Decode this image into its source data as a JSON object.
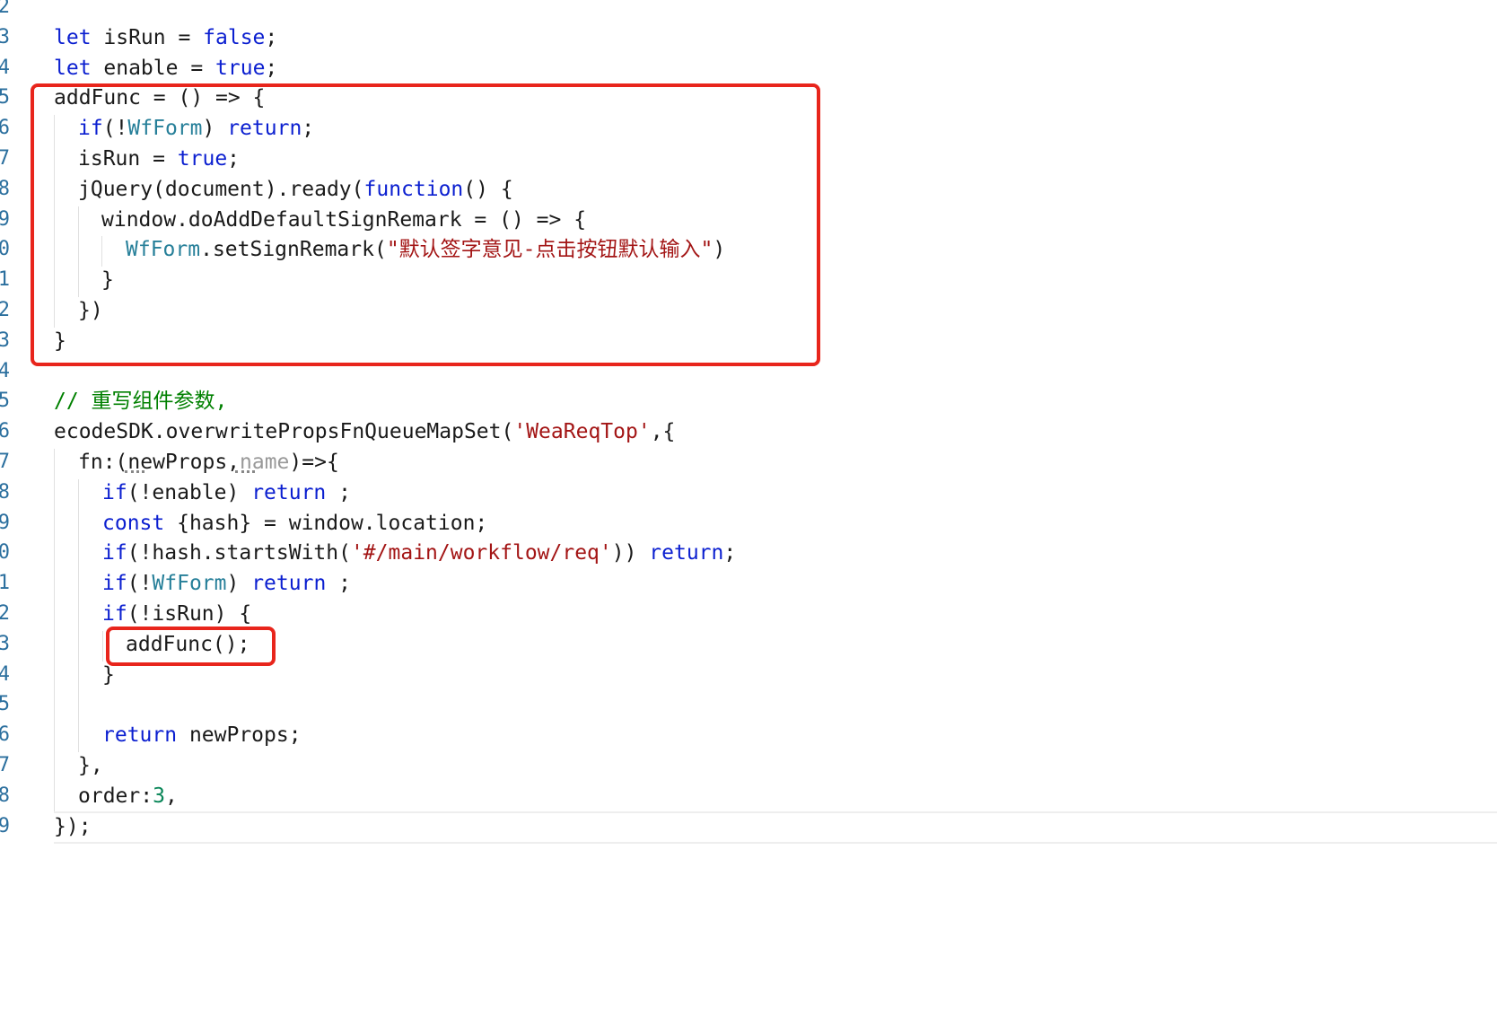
{
  "gutter": {
    "line_numbers": [
      "2",
      "3",
      "4",
      "5",
      "6",
      "7",
      "8",
      "9",
      "0",
      "1",
      "2",
      "3",
      "4",
      "5",
      "6",
      "7",
      "8",
      "9",
      "0",
      "1",
      "2",
      "3",
      "4",
      "5",
      "6",
      "7",
      "8",
      "9"
    ]
  },
  "code": {
    "lines": [
      [],
      [
        {
          "t": "let",
          "c": "kw"
        },
        {
          "t": " isRun = "
        },
        {
          "t": "false",
          "c": "kw"
        },
        {
          "t": ";"
        }
      ],
      [
        {
          "t": "let",
          "c": "kw"
        },
        {
          "t": " enable = "
        },
        {
          "t": "true",
          "c": "kw"
        },
        {
          "t": ";"
        }
      ],
      [
        {
          "t": "addFunc = () => {"
        }
      ],
      [
        {
          "t": "if",
          "c": "kw"
        },
        {
          "t": "(!"
        },
        {
          "t": "WfForm",
          "c": "ty"
        },
        {
          "t": ") "
        },
        {
          "t": "return",
          "c": "kw"
        },
        {
          "t": ";"
        }
      ],
      [
        {
          "t": "isRun = "
        },
        {
          "t": "true",
          "c": "kw"
        },
        {
          "t": ";"
        }
      ],
      [
        {
          "t": "jQuery(document).ready("
        },
        {
          "t": "function",
          "c": "kw"
        },
        {
          "t": "() {"
        }
      ],
      [
        {
          "t": "window.doAddDefaultSignRemark = () => {"
        }
      ],
      [
        {
          "t": "WfForm",
          "c": "ty"
        },
        {
          "t": ".setSignRemark("
        },
        {
          "t": "\"默认签字意见-点击按钮默认输入\"",
          "c": "str"
        },
        {
          "t": ")"
        }
      ],
      [
        {
          "t": "}"
        }
      ],
      [
        {
          "t": "})"
        }
      ],
      [
        {
          "t": "}"
        }
      ],
      [],
      [
        {
          "t": "// 重写组件参数,",
          "c": "cm"
        }
      ],
      [
        {
          "t": "ecodeSDK.overwritePropsFnQueueMapSet("
        },
        {
          "t": "'WeaReqTop'",
          "c": "str"
        },
        {
          "t": ",{"
        }
      ],
      [
        {
          "t": "fn:(newProps,"
        },
        {
          "t": "name",
          "c": "pm"
        },
        {
          "t": ")=>{"
        }
      ],
      [
        {
          "t": "if",
          "c": "kw"
        },
        {
          "t": "(!enable) "
        },
        {
          "t": "return",
          "c": "kw"
        },
        {
          "t": " ;"
        }
      ],
      [
        {
          "t": "const",
          "c": "kw"
        },
        {
          "t": " {hash} = window.location;"
        }
      ],
      [
        {
          "t": "if",
          "c": "kw"
        },
        {
          "t": "(!hash.startsWith("
        },
        {
          "t": "'#/main/workflow/req'",
          "c": "str"
        },
        {
          "t": ")) "
        },
        {
          "t": "return",
          "c": "kw"
        },
        {
          "t": ";"
        }
      ],
      [
        {
          "t": "if",
          "c": "kw"
        },
        {
          "t": "(!"
        },
        {
          "t": "WfForm",
          "c": "ty"
        },
        {
          "t": ") "
        },
        {
          "t": "return",
          "c": "kw"
        },
        {
          "t": " ;"
        }
      ],
      [
        {
          "t": "if",
          "c": "kw"
        },
        {
          "t": "(!isRun) {"
        }
      ],
      [
        {
          "t": "addFunc();"
        }
      ],
      [
        {
          "t": "}"
        }
      ],
      [],
      [
        {
          "t": "return",
          "c": "kw"
        },
        {
          "t": " newProps;"
        }
      ],
      [
        {
          "t": "},"
        }
      ],
      [
        {
          "t": "order:"
        },
        {
          "t": "3",
          "c": "num"
        },
        {
          "t": ","
        }
      ],
      [
        {
          "t": "});"
        }
      ]
    ]
  },
  "colors": {
    "keyword": "#0b1fd0",
    "string": "#a31515",
    "type": "#267f99",
    "number": "#098658",
    "comment": "#008000",
    "unused_param": "#999999",
    "gutter_number": "#2b6f9e",
    "annotation_box": "#e8251c"
  }
}
